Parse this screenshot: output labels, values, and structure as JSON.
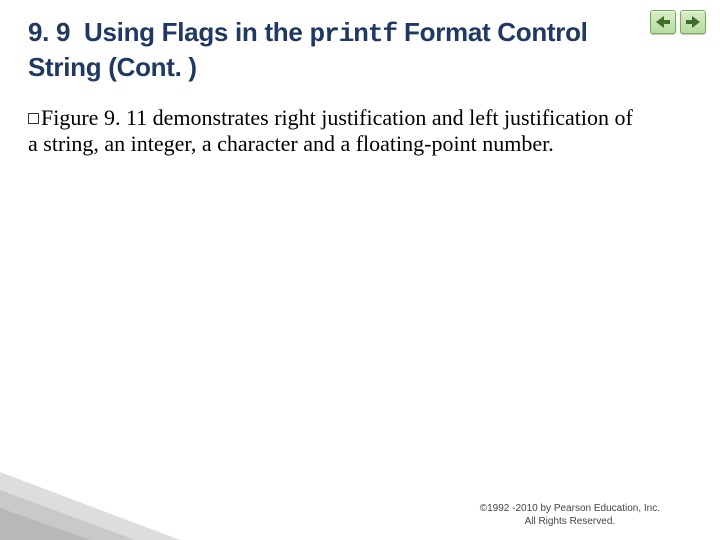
{
  "title": {
    "section_number": "9. 9",
    "part1": "Using Flags in the",
    "code": "printf",
    "part2": "Format Control String (Cont. )"
  },
  "body": {
    "bullet_lead": "Figure",
    "text": "9. 11 demonstrates right justification and left justification of a string, an integer, a character and a floating-point number."
  },
  "nav": {
    "prev_icon": "prev-arrow-icon",
    "next_icon": "next-arrow-icon"
  },
  "footer": {
    "line1": "©1992 -2010 by Pearson Education, Inc.",
    "line2": "All Rights Reserved."
  }
}
